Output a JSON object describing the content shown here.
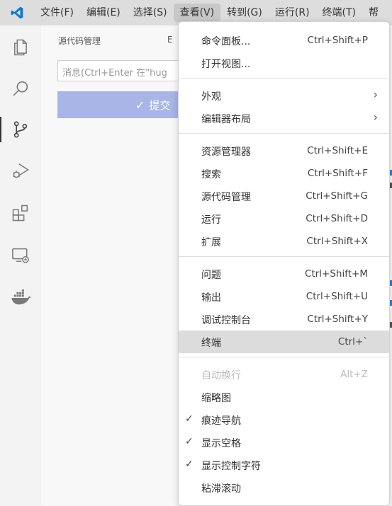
{
  "menubar": {
    "items": [
      {
        "label": "文件(F)"
      },
      {
        "label": "编辑(E)"
      },
      {
        "label": "选择(S)"
      },
      {
        "label": "查看(V)"
      },
      {
        "label": "转到(G)"
      },
      {
        "label": "运行(R)"
      },
      {
        "label": "终端(T)"
      },
      {
        "label": "帮"
      }
    ],
    "active_index": 3
  },
  "activitybar": {
    "icons": [
      "explorer-icon",
      "search-icon",
      "source-control-icon",
      "run-debug-icon",
      "extensions-icon",
      "remote-explorer-icon",
      "docker-icon"
    ],
    "active_index": 2
  },
  "sidebar": {
    "title": "源代码管理",
    "title_right": "E",
    "commit_input_placeholder": "消息(Ctrl+Enter 在\"hug",
    "commit_button_label": "提交"
  },
  "view_menu": {
    "groups": [
      [
        {
          "label": "命令面板...",
          "shortcut": "Ctrl+Shift+P"
        },
        {
          "label": "打开视图...",
          "shortcut": ""
        }
      ],
      [
        {
          "label": "外观",
          "submenu": true
        },
        {
          "label": "编辑器布局",
          "submenu": true
        }
      ],
      [
        {
          "label": "资源管理器",
          "shortcut": "Ctrl+Shift+E"
        },
        {
          "label": "搜索",
          "shortcut": "Ctrl+Shift+F"
        },
        {
          "label": "源代码管理",
          "shortcut": "Ctrl+Shift+G"
        },
        {
          "label": "运行",
          "shortcut": "Ctrl+Shift+D"
        },
        {
          "label": "扩展",
          "shortcut": "Ctrl+Shift+X"
        }
      ],
      [
        {
          "label": "问题",
          "shortcut": "Ctrl+Shift+M"
        },
        {
          "label": "输出",
          "shortcut": "Ctrl+Shift+U"
        },
        {
          "label": "调试控制台",
          "shortcut": "Ctrl+Shift+Y"
        },
        {
          "label": "终端",
          "shortcut": "Ctrl+`",
          "highlighted": true
        }
      ],
      [
        {
          "label": "自动换行",
          "shortcut": "Alt+Z",
          "disabled": true
        },
        {
          "label": "缩略图",
          "shortcut": ""
        },
        {
          "label": "痕迹导航",
          "checked": true
        },
        {
          "label": "显示空格",
          "checked": true
        },
        {
          "label": "显示控制字符",
          "checked": true
        },
        {
          "label": "粘滞滚动",
          "shortcut": ""
        }
      ]
    ]
  },
  "colors": {
    "accent": "#007acc",
    "commit_button": "#a8b5e6",
    "highlight": "#dcdcdc"
  }
}
